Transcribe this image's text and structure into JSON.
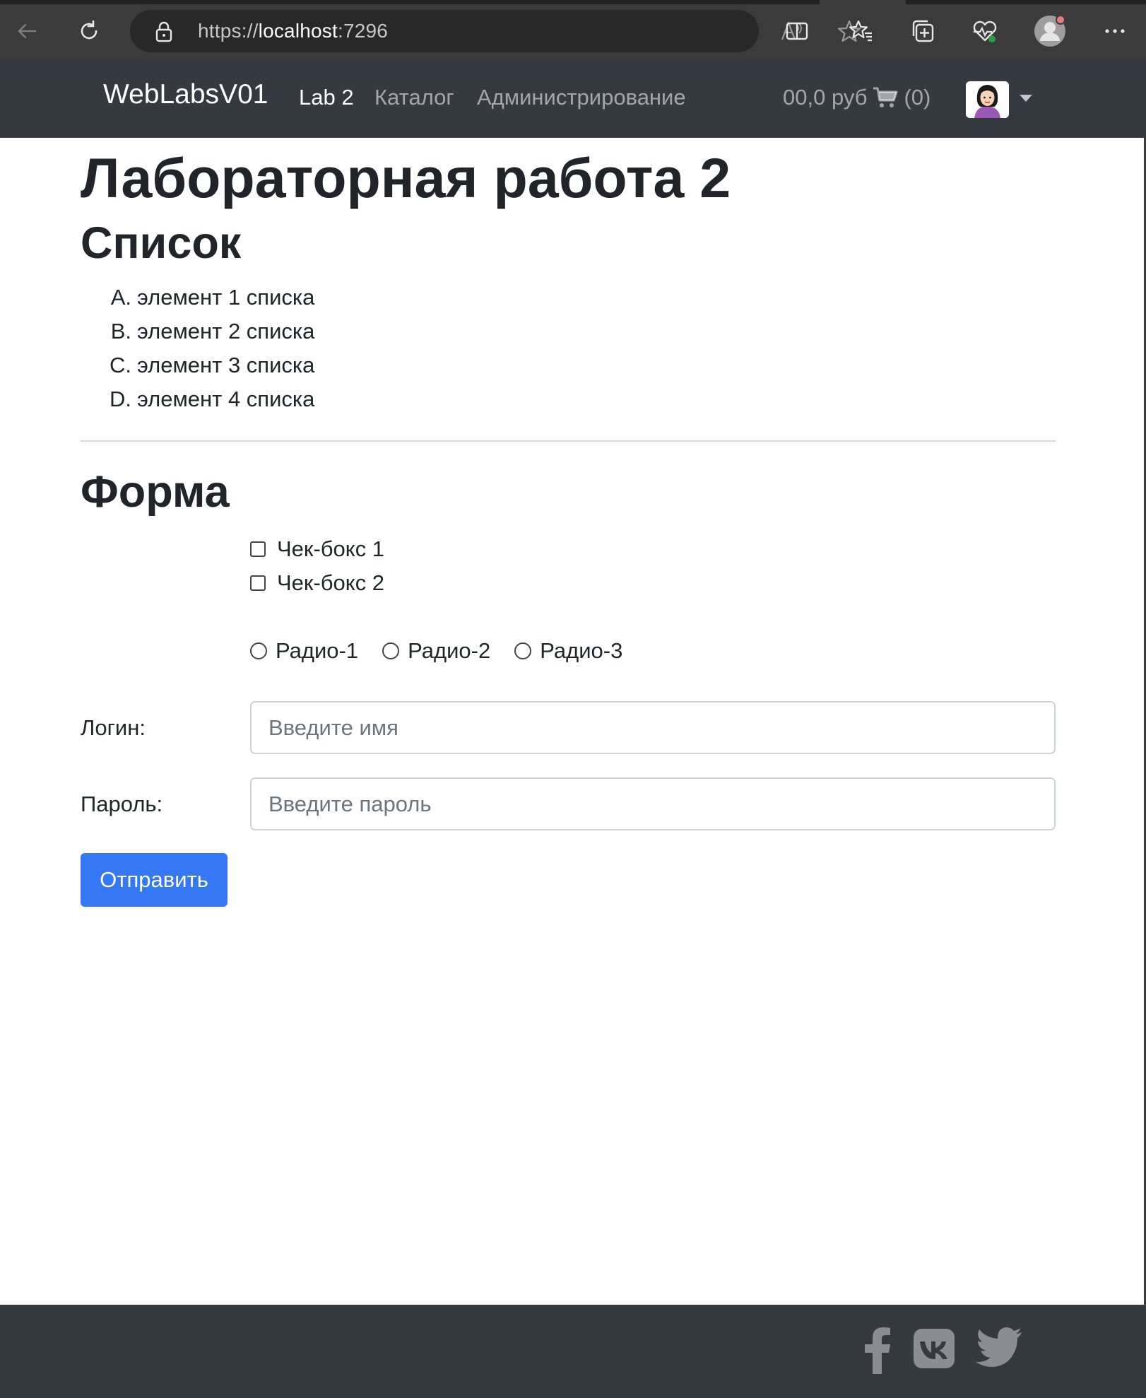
{
  "browser": {
    "url_scheme": "https://",
    "url_host": "localhost",
    "url_port": ":7296"
  },
  "navbar": {
    "brand": "WebLabsV01",
    "links": [
      {
        "label": "Lab 2"
      },
      {
        "label": "Каталог"
      },
      {
        "label": "Администрирование"
      }
    ],
    "cart_amount": "00,0 руб",
    "cart_count": "(0)"
  },
  "page": {
    "title": "Лабораторная работа 2",
    "list_heading": "Список",
    "list_items": [
      {
        "marker": "A.",
        "text": "элемент 1 списка"
      },
      {
        "marker": "B.",
        "text": "элемент 2 списка"
      },
      {
        "marker": "C.",
        "text": "элемент 3 списка"
      },
      {
        "marker": "D.",
        "text": "элемент 4 списка"
      }
    ],
    "form_heading": "Форма",
    "checkboxes": [
      {
        "label": "Чек-бокс 1",
        "checked": false
      },
      {
        "label": "Чек-бокс 2",
        "checked": false
      }
    ],
    "radios": [
      {
        "label": "Радио-1",
        "checked": false
      },
      {
        "label": "Радио-2",
        "checked": false
      },
      {
        "label": "Радио-3",
        "checked": false
      }
    ],
    "login_label": "Логин:",
    "login_placeholder": "Введите имя",
    "password_label": "Пароль:",
    "password_placeholder": "Введите пароль",
    "submit_label": "Отправить"
  },
  "footer": {
    "icons": [
      "facebook-icon",
      "vk-icon",
      "twitter-icon"
    ]
  },
  "colors": {
    "navbar_bg": "#343a40",
    "primary_button": "#3478f6",
    "browser_chrome": "#3b3b3b"
  }
}
